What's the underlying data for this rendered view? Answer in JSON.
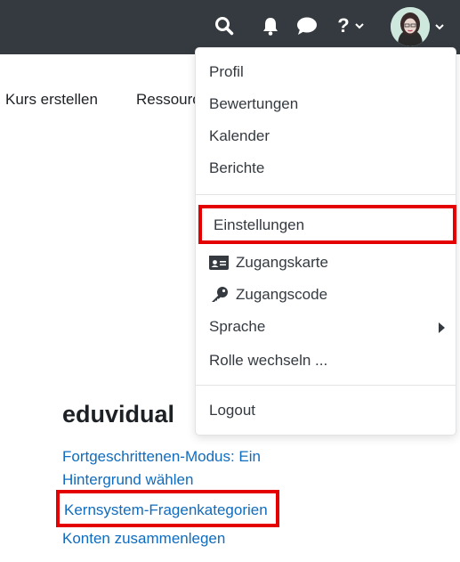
{
  "navbar": {
    "help_label": "?"
  },
  "secondary_nav": {
    "items": [
      "Kurs erstellen",
      "Ressource"
    ]
  },
  "user_menu": {
    "items": {
      "profil": "Profil",
      "bewertungen": "Bewertungen",
      "kalender": "Kalender",
      "berichte": "Berichte",
      "einstellungen": "Einstellungen",
      "zugangskarte": "Zugangskarte",
      "zugangscode": "Zugangscode",
      "sprache": "Sprache",
      "rolle_wechseln": "Rolle wechseln ...",
      "logout": "Logout"
    }
  },
  "section": {
    "title": "eduvidual",
    "links": [
      "Fortgeschrittenen-Modus: Ein",
      "Hintergrund wählen",
      "Kernsystem-Fragenkategorien",
      "Konten zusammenlegen"
    ]
  },
  "colors": {
    "navbar": "#343a40",
    "link": "#0f6cbf",
    "highlight": "#e40000"
  },
  "icons": [
    "search-icon",
    "bell-icon",
    "chat-icon",
    "chevron-down-icon",
    "id-card-icon",
    "key-icon",
    "caret-right-icon"
  ]
}
